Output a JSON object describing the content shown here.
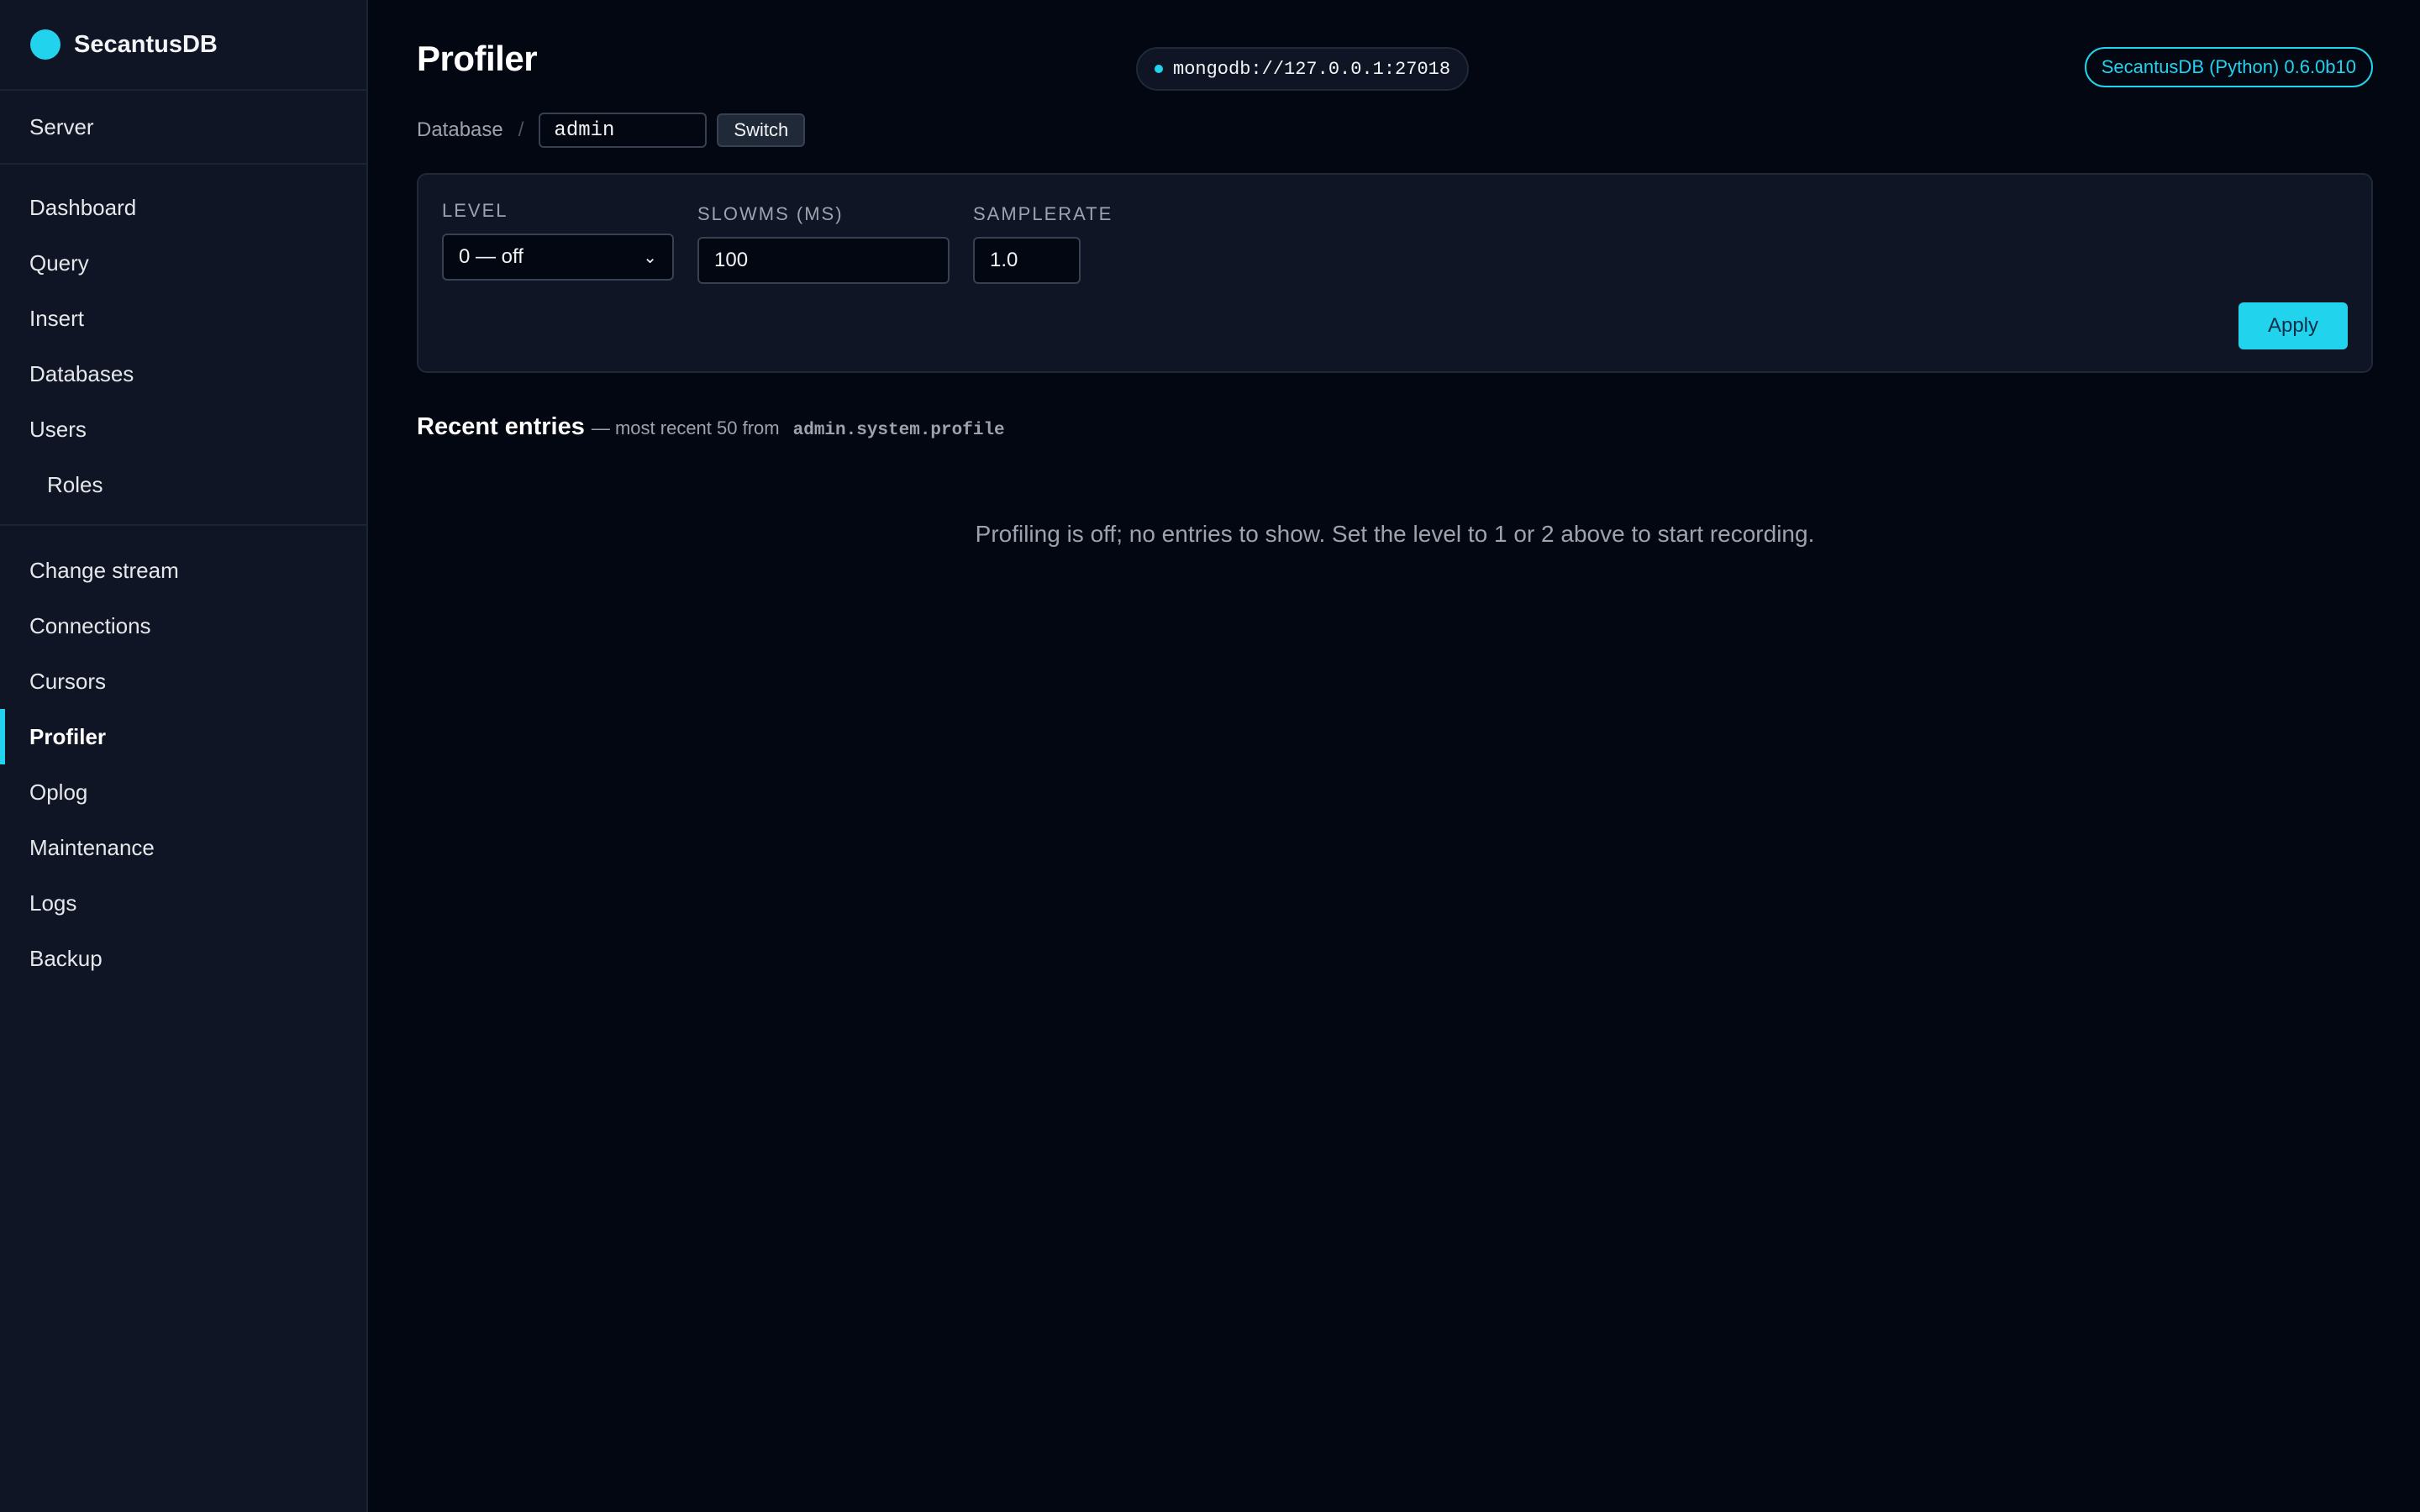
{
  "brand": {
    "name": "SecantusDB"
  },
  "sidebar": {
    "server": {
      "label": "Server"
    },
    "main_items": [
      {
        "label": "Dashboard"
      },
      {
        "label": "Query"
      },
      {
        "label": "Insert"
      },
      {
        "label": "Databases"
      },
      {
        "label": "Users"
      },
      {
        "label": "Roles"
      }
    ],
    "tool_items": [
      {
        "label": "Change stream"
      },
      {
        "label": "Connections"
      },
      {
        "label": "Cursors"
      },
      {
        "label": "Profiler",
        "active": true
      },
      {
        "label": "Oplog"
      },
      {
        "label": "Maintenance"
      },
      {
        "label": "Logs"
      },
      {
        "label": "Backup"
      }
    ]
  },
  "header": {
    "title": "Profiler",
    "connection": "mongodb://127.0.0.1:27018",
    "version": "SecantusDB (Python) 0.6.0b10"
  },
  "breadcrumb": {
    "label": "Database",
    "separator": "/",
    "db_value": "admin",
    "switch_label": "Switch"
  },
  "settings": {
    "level_label": "Level",
    "level_value": "0 — off",
    "slowms_label": "Slowms (ms)",
    "slowms_value": "100",
    "samplerate_label": "Samplerate",
    "samplerate_value": "1.0",
    "apply_label": "Apply"
  },
  "recent": {
    "title": "Recent entries",
    "subtitle": "— most recent 50 from",
    "collection": "admin.system.profile",
    "empty_message": "Profiling is off; no entries to show. Set the level to 1 or 2 above to start recording."
  },
  "colors": {
    "accent": "#22d3ee",
    "background": "#030712",
    "sidebar": "#0f1524"
  }
}
